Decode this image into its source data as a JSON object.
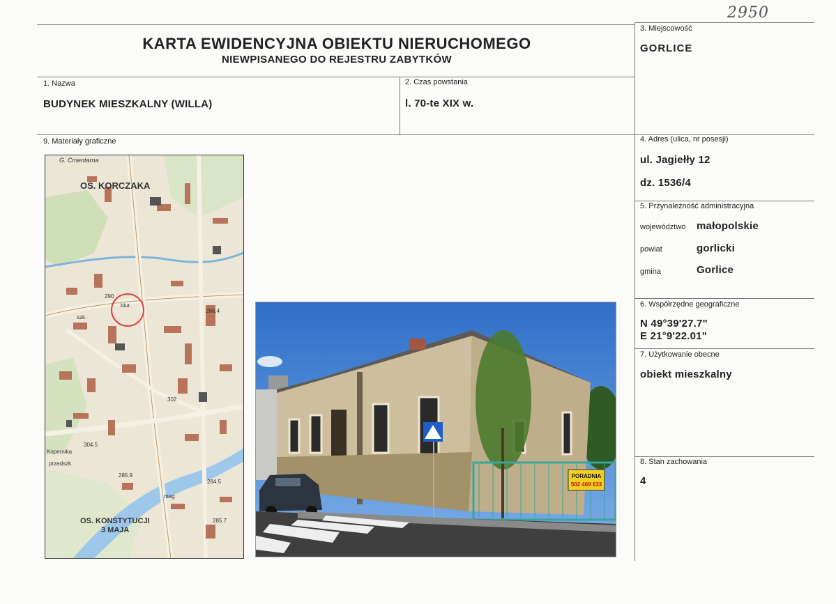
{
  "inventory_number": "2950",
  "title": {
    "line1": "KARTA EWIDENCYJNA OBIEKTU NIERUCHOMEGO",
    "line2": "NIEWPISANEGO DO REJESTRU ZABYTKÓW"
  },
  "fields": {
    "name": {
      "label": "1. Nazwa",
      "value": "BUDYNEK MIESZKALNY (WILLA)"
    },
    "period": {
      "label": "2. Czas powstania",
      "value": "l. 70-te XIX w."
    },
    "locality": {
      "label": "3. Miejscowość",
      "value": "GORLICE"
    },
    "address": {
      "label": "4. Adres (ulica, nr posesji)",
      "street": "ul. Jagiełły 12",
      "plot": "dz. 1536/4"
    },
    "admin": {
      "label": "5. Przynależność administracyjna",
      "voivodeship_label": "województwo",
      "voivodeship": "małopolskie",
      "county_label": "powiat",
      "county": "gorlicki",
      "commune_label": "gmina",
      "commune": "Gorlice"
    },
    "coords": {
      "label": "6. Współrzędne geograficzne",
      "lat": "N 49°39'27.7\"",
      "lon": "E 21°9'22.01\""
    },
    "use": {
      "label": "7. Użytkowanie obecne",
      "value": "obiekt mieszkalny"
    },
    "condition": {
      "label": "8. Stan zachowania",
      "value": "4"
    },
    "graphics": {
      "label": "9. Materiały graficzne"
    }
  },
  "map": {
    "labels": [
      "G. Cmentarna",
      "OS. KORCZAKA",
      "290",
      "286.4",
      "302",
      "304.5",
      "OS. KONSTYTUCJI",
      "3 MAJA",
      "285.7",
      "284.5",
      "285.9",
      "Kopernika",
      "szk.",
      "biur.",
      "mag",
      "przedszk."
    ]
  },
  "photo": {
    "sign_line1": "PORADNIA",
    "sign_line2": "502 469 633"
  }
}
